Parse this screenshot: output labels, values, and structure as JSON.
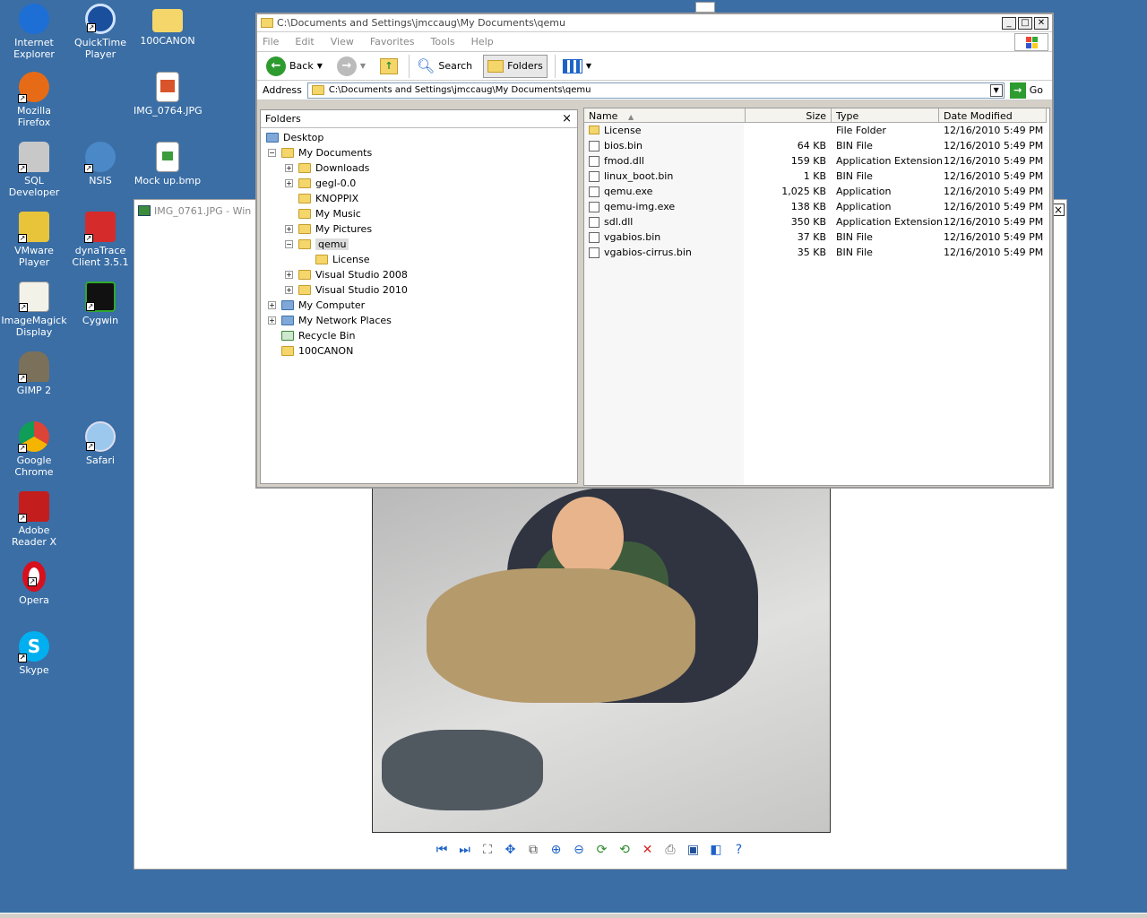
{
  "desktop": {
    "icons": [
      {
        "label": "Internet Explorer"
      },
      {
        "label": "QuickTime Player"
      },
      {
        "label": "100CANON"
      },
      {
        "label": "Mozilla Firefox"
      },
      {
        "label": "IMG_0764.JPG"
      },
      {
        "label": "SQL Developer"
      },
      {
        "label": "NSIS"
      },
      {
        "label": "Mock up.bmp"
      },
      {
        "label": "VMware Player"
      },
      {
        "label": "dynaTrace Client 3.5.1"
      },
      {
        "label": "ImageMagick Display"
      },
      {
        "label": "Cygwin"
      },
      {
        "label": "GIMP 2"
      },
      {
        "label": "Google Chrome"
      },
      {
        "label": "Safari"
      },
      {
        "label": "Adobe Reader X"
      },
      {
        "label": "Opera"
      },
      {
        "label": "Skype"
      }
    ]
  },
  "viewer": {
    "title": "IMG_0761.JPG - Win",
    "close": "×"
  },
  "explorer": {
    "title": "C:\\Documents and Settings\\jmccaug\\My Documents\\qemu",
    "menu": [
      "File",
      "Edit",
      "View",
      "Favorites",
      "Tools",
      "Help"
    ],
    "toolbar": {
      "back": "Back",
      "search": "Search",
      "folders": "Folders"
    },
    "address_label": "Address",
    "address_value": "C:\\Documents and Settings\\jmccaug\\My Documents\\qemu",
    "go_label": "Go",
    "folders_title": "Folders",
    "folders_close": "×",
    "tree": [
      {
        "label": "Desktop",
        "pm": ""
      },
      {
        "label": "My Documents",
        "pm": "−"
      },
      {
        "label": "Downloads",
        "pm": "+"
      },
      {
        "label": "gegl-0.0",
        "pm": "+"
      },
      {
        "label": "KNOPPIX",
        "pm": ""
      },
      {
        "label": "My Music",
        "pm": ""
      },
      {
        "label": "My Pictures",
        "pm": "+"
      },
      {
        "label": "qemu",
        "pm": "−"
      },
      {
        "label": "License",
        "pm": ""
      },
      {
        "label": "Visual Studio 2008",
        "pm": "+"
      },
      {
        "label": "Visual Studio 2010",
        "pm": "+"
      },
      {
        "label": "My Computer",
        "pm": "+"
      },
      {
        "label": "My Network Places",
        "pm": "+"
      },
      {
        "label": "Recycle Bin",
        "pm": ""
      },
      {
        "label": "100CANON",
        "pm": ""
      }
    ],
    "columns": {
      "name": "Name",
      "size": "Size",
      "type": "Type",
      "date": "Date Modified"
    },
    "files": [
      {
        "name": "License",
        "size": "",
        "type": "File Folder",
        "date": "12/16/2010 5:49 PM"
      },
      {
        "name": "bios.bin",
        "size": "64 KB",
        "type": "BIN File",
        "date": "12/16/2010 5:49 PM"
      },
      {
        "name": "fmod.dll",
        "size": "159 KB",
        "type": "Application Extension",
        "date": "12/16/2010 5:49 PM"
      },
      {
        "name": "linux_boot.bin",
        "size": "1 KB",
        "type": "BIN File",
        "date": "12/16/2010 5:49 PM"
      },
      {
        "name": "qemu.exe",
        "size": "1,025 KB",
        "type": "Application",
        "date": "12/16/2010 5:49 PM"
      },
      {
        "name": "qemu-img.exe",
        "size": "138 KB",
        "type": "Application",
        "date": "12/16/2010 5:49 PM"
      },
      {
        "name": "sdl.dll",
        "size": "350 KB",
        "type": "Application Extension",
        "date": "12/16/2010 5:49 PM"
      },
      {
        "name": "vgabios.bin",
        "size": "37 KB",
        "type": "BIN File",
        "date": "12/16/2010 5:49 PM"
      },
      {
        "name": "vgabios-cirrus.bin",
        "size": "35 KB",
        "type": "BIN File",
        "date": "12/16/2010 5:49 PM"
      }
    ]
  },
  "colors": {
    "desktop": "#3a6ea5",
    "selection": "#dcdcdc"
  }
}
